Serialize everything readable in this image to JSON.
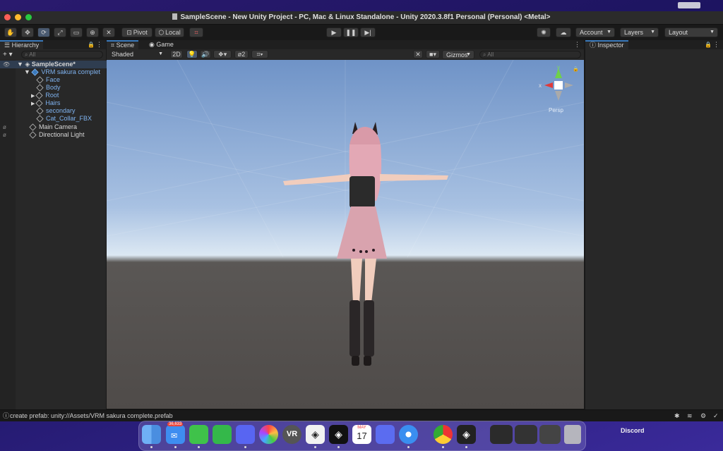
{
  "window": {
    "title": "SampleScene - New Unity Project - PC, Mac & Linux Standalone - Unity 2020.3.8f1 Personal (Personal) <Metal>"
  },
  "toolbar": {
    "pivot_label": "Pivot",
    "local_label": "Local",
    "account_label": "Account",
    "layers_label": "Layers",
    "layout_label": "Layout"
  },
  "hierarchy": {
    "tab_label": "Hierarchy",
    "search_placeholder": "All",
    "items": [
      {
        "label": "SampleScene*"
      },
      {
        "label": "VRM sakura complet"
      },
      {
        "label": "Face"
      },
      {
        "label": "Body"
      },
      {
        "label": "Root"
      },
      {
        "label": "Hairs"
      },
      {
        "label": "secondary"
      },
      {
        "label": "Cat_Collar_FBX"
      },
      {
        "label": "Main Camera"
      },
      {
        "label": "Directional Light"
      }
    ]
  },
  "scene": {
    "tabs": [
      {
        "label": "Scene"
      },
      {
        "label": "Game"
      }
    ],
    "shading_mode": "Shaded",
    "mode_2d": "2D",
    "hidden_count": "2",
    "gizmos_label": "Gizmos",
    "search_placeholder": "All",
    "gizmo_axes": {
      "y": "y",
      "x": "x"
    },
    "projection_label": "Persp"
  },
  "inspector": {
    "tab_label": "Inspector"
  },
  "status_bar": {
    "message": "create prefab: unity://Assets/VRM sakura complete.prefab"
  },
  "dock": {
    "mail_badge": "36,633",
    "calendar_month": "MAY",
    "calendar_day": "17",
    "discord_label": "Discord",
    "vr_label": "VR"
  },
  "colors": {
    "accent": "#3a79bb",
    "sky_top": "#6f93c7",
    "ground": "#4f4b49"
  }
}
